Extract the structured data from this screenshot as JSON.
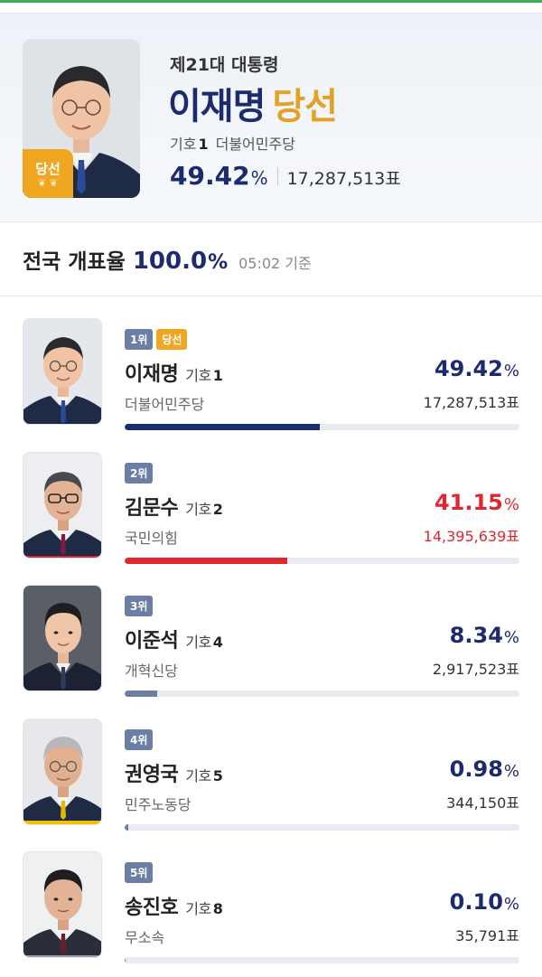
{
  "winner": {
    "election_name": "제21대 대통령",
    "name": "이재명",
    "elected_label": "당선",
    "number_label": "기호",
    "number": "1",
    "party": "더불어민주당",
    "percent": "49.42",
    "percent_unit": "%",
    "votes": "17,287,513표",
    "badge": "당선",
    "badge_icon": "laurel-icon"
  },
  "counting": {
    "label": "전국 개표율",
    "rate": "100.0",
    "unit": "%",
    "time": "05:02 기준"
  },
  "candidates": [
    {
      "rank": "1위",
      "elected": "당선",
      "name": "이재명",
      "number_label": "기호",
      "number": "1",
      "party": "더불어민주당",
      "percent": "49.42",
      "unit": "%",
      "votes": "17,287,513표",
      "share": 0.4942,
      "color": "#1c2a6e",
      "bar_color": "#1c2a6e"
    },
    {
      "rank": "2위",
      "elected": "",
      "name": "김문수",
      "number_label": "기호",
      "number": "2",
      "party": "국민의힘",
      "percent": "41.15",
      "unit": "%",
      "votes": "14,395,639표",
      "share": 0.4115,
      "color": "#e0262f",
      "bar_color": "#e0262f"
    },
    {
      "rank": "3위",
      "elected": "",
      "name": "이준석",
      "number_label": "기호",
      "number": "4",
      "party": "개혁신당",
      "percent": "8.34",
      "unit": "%",
      "votes": "2,917,523표",
      "share": 0.0834,
      "color": "#1c2a6e",
      "bar_color": "#6c7ea6"
    },
    {
      "rank": "4위",
      "elected": "",
      "name": "권영국",
      "number_label": "기호",
      "number": "5",
      "party": "민주노동당",
      "percent": "0.98",
      "unit": "%",
      "votes": "344,150표",
      "share": 0.0098,
      "color": "#1c2a6e",
      "bar_color": "#6c7ea6"
    },
    {
      "rank": "5위",
      "elected": "",
      "name": "송진호",
      "number_label": "기호",
      "number": "8",
      "party": "무소속",
      "percent": "0.10",
      "unit": "%",
      "votes": "35,791표",
      "share": 0.001,
      "color": "#1c2a6e",
      "bar_color": "#6c7ea6"
    }
  ]
}
